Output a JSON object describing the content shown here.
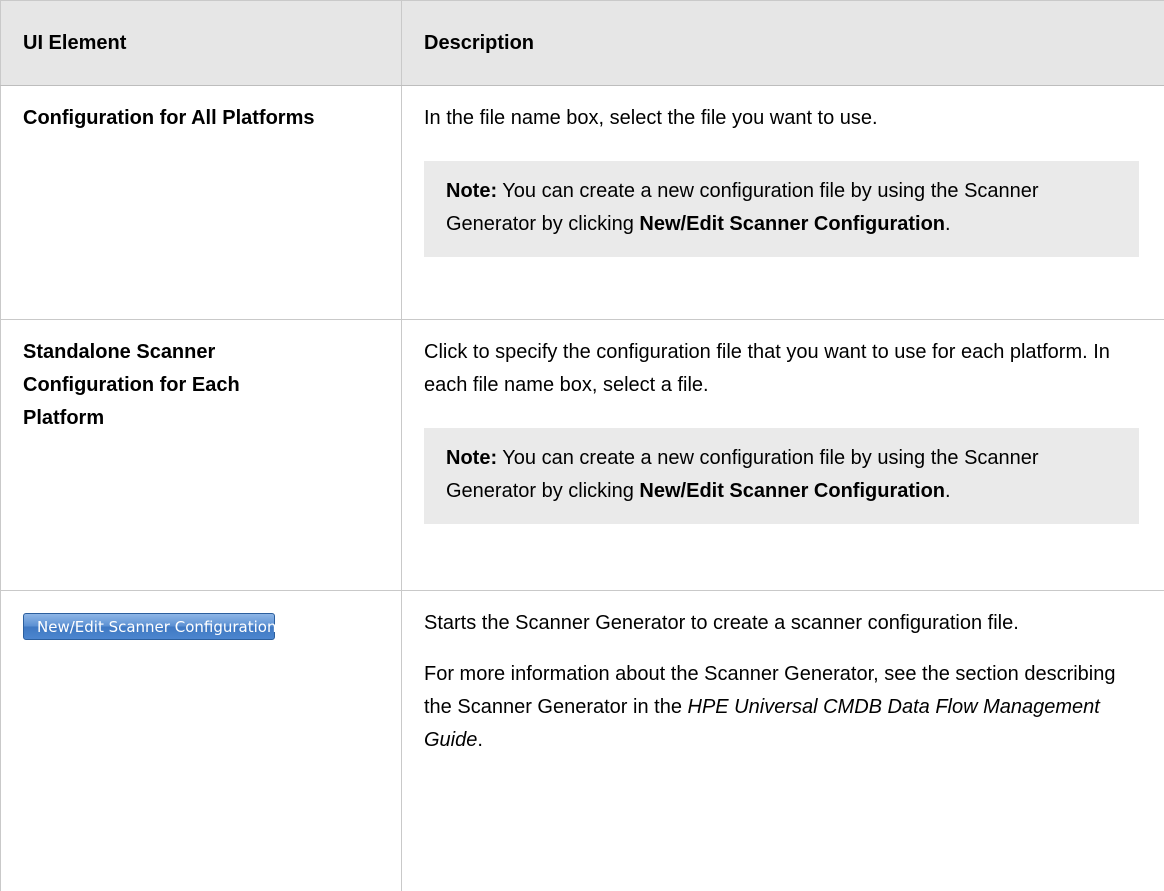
{
  "table": {
    "headers": [
      "UI Element",
      "Description"
    ],
    "rows": [
      {
        "element": "Configuration for All Platforms",
        "description": "In the file name box, select the file you want to use.",
        "note": {
          "label": "Note:",
          "text": " You can create a new configuration file by using the Scanner Generator by clicking ",
          "bold": "New/Edit Scanner Configuration",
          "end": "."
        }
      },
      {
        "element": "Standalone Scanner Configuration for Each Platform",
        "description": "Click to specify the configuration file that you want to use for each platform. In each file name box, select a file.",
        "note": {
          "label": "Note:",
          "text": " You can create a new configuration file by using the Scanner Generator by clicking ",
          "bold": "New/Edit Scanner Configuration",
          "end": "."
        }
      },
      {
        "element_button": "New/Edit Scanner Configuration...",
        "description": "Starts the Scanner Generator to create a scanner configuration file.",
        "more_pre": "For more information about the Scanner Generator, see the section describing the Scanner Generator in the ",
        "more_guide": "HPE Universal CMDB Data Flow Management Guide",
        "more_end": "."
      }
    ]
  }
}
